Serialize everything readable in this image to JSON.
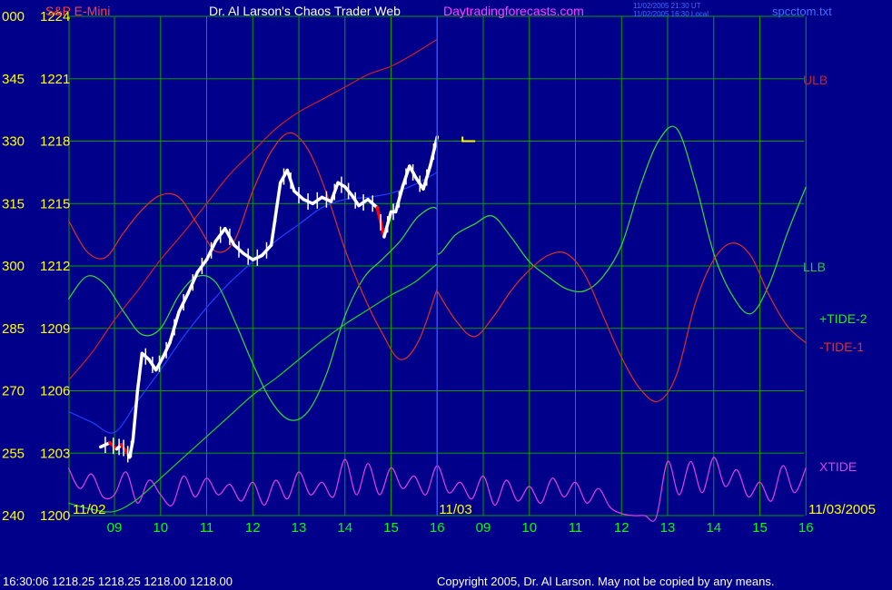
{
  "header": {
    "instrument": "S&P E-Mini",
    "author": "Dr. Al Larson's Chaos Trader Web",
    "site": "Daytradingforecasts.com",
    "timestamp_ut": "11/02/2005 21:30 UT",
    "timestamp_local": "11/02/2005 16:30 Local",
    "filename": "spcctom.txt"
  },
  "footer": {
    "quote": "16:30:06  1218.25  1218.25  1218.00  1218.00",
    "copyright": "Copyright 2005, Dr. Al Larson. May not be copied by any means."
  },
  "colors": {
    "background": "#00008b",
    "grid": "#00a000",
    "price_bar": "#ffffff",
    "down_bar": "#ff0000",
    "ulb": "#d02020",
    "llb": "#20d020",
    "tide_plus_2": "#30e030",
    "tide_minus_1": "#e03020",
    "xtide": "#e040e0",
    "average": "#2040ff",
    "now_line": "#3050ff",
    "axis_text": "#ffff00",
    "date_text": "#ffff00",
    "time_text": "#00ff00"
  },
  "chart_data": {
    "type": "line",
    "x_axis": {
      "date_labels": [
        "11/02",
        "11/03",
        "11/03/2005"
      ],
      "time_ticks": [
        "09",
        "10",
        "11",
        "12",
        "13",
        "14",
        "15",
        "16",
        "09",
        "10",
        "11",
        "12",
        "13",
        "14",
        "15",
        "16"
      ]
    },
    "y_axis": {
      "ylim": [
        1200,
        1224
      ],
      "ticks": [
        {
          "angle": "000",
          "price": "1224"
        },
        {
          "angle": "345",
          "price": "1221"
        },
        {
          "angle": "330",
          "price": "1218"
        },
        {
          "angle": "315",
          "price": "1215"
        },
        {
          "angle": "300",
          "price": "1212"
        },
        {
          "angle": "285",
          "price": "1209"
        },
        {
          "angle": "270",
          "price": "1206"
        },
        {
          "angle": "255",
          "price": "1203"
        },
        {
          "angle": "240",
          "price": "1200"
        }
      ]
    },
    "legend": [
      {
        "label": "ULB",
        "series": "ulb"
      },
      {
        "label": "LLB",
        "series": "llb"
      },
      {
        "label": "+TIDE-2",
        "series": "tide_plus_2"
      },
      {
        "label": "-TIDE-1",
        "series": "tide_minus_1"
      },
      {
        "label": "XTIDE",
        "series": "xtide"
      }
    ],
    "price": {
      "x": [
        8.7,
        8.9,
        9.05,
        9.15,
        9.25,
        9.33,
        9.4,
        9.5,
        9.6,
        9.75,
        9.9,
        10.05,
        10.2,
        10.4,
        10.6,
        10.8,
        11.0,
        11.2,
        11.4,
        11.6,
        11.8,
        12.0,
        12.2,
        12.4,
        12.6,
        12.75,
        12.9,
        13.1,
        13.3,
        13.5,
        13.7,
        13.85,
        14.0,
        14.15,
        14.3,
        14.5,
        14.7,
        14.85,
        15.0,
        15.1,
        15.25,
        15.4,
        15.55,
        15.7,
        15.85,
        16.0
      ],
      "y": [
        1203.3,
        1203.5,
        1203.2,
        1203.4,
        1203.1,
        1202.8,
        1203.6,
        1206.0,
        1207.8,
        1207.5,
        1207.0,
        1207.6,
        1208.3,
        1209.8,
        1210.7,
        1211.7,
        1212.3,
        1213.2,
        1213.8,
        1213.0,
        1212.6,
        1212.3,
        1212.5,
        1213.0,
        1216.0,
        1216.6,
        1215.6,
        1215.2,
        1215.0,
        1215.3,
        1215.1,
        1216.0,
        1215.8,
        1215.4,
        1214.9,
        1215.2,
        1214.8,
        1213.4,
        1214.6,
        1214.6,
        1215.8,
        1216.8,
        1216.2,
        1215.7,
        1216.8,
        1218.2
      ]
    },
    "series": [
      {
        "id": "ulb",
        "x": [
          8.0,
          8.5,
          9.0,
          9.5,
          10.0,
          10.5,
          11.0,
          11.5,
          12.0,
          12.5,
          13.0,
          13.5,
          14.0,
          14.5,
          15.0,
          15.5,
          16.0
        ],
        "y": [
          1206.5,
          1207.8,
          1209.4,
          1210.8,
          1212.3,
          1213.6,
          1215.0,
          1216.4,
          1217.5,
          1218.6,
          1219.4,
          1220.0,
          1220.6,
          1221.2,
          1221.6,
          1222.2,
          1222.9
        ]
      },
      {
        "id": "llb",
        "x": [
          8.0,
          8.5,
          9.0,
          9.5,
          10.0,
          10.5,
          11.0,
          11.5,
          12.0,
          12.5,
          13.0,
          13.5,
          14.0,
          14.5,
          15.0,
          15.5,
          16.0
        ],
        "y": [
          1200.6,
          1200.3,
          1200.2,
          1200.8,
          1201.8,
          1202.8,
          1203.8,
          1204.8,
          1205.8,
          1206.6,
          1207.5,
          1208.4,
          1209.2,
          1209.9,
          1210.6,
          1211.2,
          1212.1
        ]
      },
      {
        "id": "average",
        "x": [
          8.0,
          8.5,
          9.0,
          9.5,
          10.0,
          10.5,
          11.0,
          11.5,
          12.0,
          12.5,
          13.0,
          13.5,
          14.0,
          14.5,
          15.0,
          15.5,
          16.0
        ],
        "y": [
          1205.0,
          1204.5,
          1204.0,
          1205.5,
          1207.0,
          1208.6,
          1210.0,
          1211.2,
          1212.2,
          1213.2,
          1214.0,
          1214.8,
          1215.2,
          1215.3,
          1215.5,
          1215.9,
          1216.5
        ]
      },
      {
        "id": "tide_plus_2",
        "x": [
          8.0,
          8.4,
          8.8,
          9.2,
          9.6,
          10.0,
          10.4,
          10.8,
          11.2,
          11.6,
          12.0,
          12.4,
          12.8,
          13.2,
          13.6,
          14.0,
          14.4,
          14.8,
          15.2,
          15.6,
          16.0,
          16.0,
          16.4,
          16.8,
          17.2,
          17.6,
          18.0,
          18.4,
          18.8,
          19.2,
          19.6,
          20.0,
          20.4,
          20.8,
          21.2,
          21.6,
          22.0,
          22.4,
          22.8,
          23.2,
          23.6,
          24.0
        ],
        "y": [
          1210.4,
          1211.5,
          1211.1,
          1209.8,
          1208.7,
          1209.0,
          1210.6,
          1211.5,
          1211.2,
          1209.4,
          1207.3,
          1205.5,
          1204.6,
          1205.0,
          1206.8,
          1209.6,
          1211.4,
          1212.3,
          1213.2,
          1214.4,
          1214.7,
          1212.6,
          1213.5,
          1214.0,
          1214.4,
          1213.4,
          1212.2,
          1211.5,
          1210.9,
          1210.8,
          1211.5,
          1213.0,
          1215.8,
          1218.0,
          1218.6,
          1216.0,
          1212.6,
          1210.6,
          1209.7,
          1211.1,
          1213.6,
          1215.8
        ]
      },
      {
        "id": "tide_minus_1",
        "x": [
          8.0,
          8.4,
          8.8,
          9.2,
          9.6,
          10.0,
          10.4,
          10.8,
          11.2,
          11.6,
          12.0,
          12.4,
          12.8,
          13.2,
          13.6,
          14.0,
          14.4,
          14.8,
          15.2,
          15.6,
          16.0,
          16.0,
          16.4,
          16.8,
          17.2,
          17.6,
          18.0,
          18.4,
          18.8,
          19.2,
          19.6,
          20.0,
          20.4,
          20.8,
          21.2,
          21.6,
          22.0,
          22.4,
          22.8,
          23.2,
          23.6,
          24.0
        ],
        "y": [
          1214.2,
          1212.7,
          1212.4,
          1213.6,
          1214.7,
          1215.4,
          1215.3,
          1214.0,
          1212.7,
          1213.2,
          1215.6,
          1217.5,
          1218.4,
          1217.6,
          1215.5,
          1212.8,
          1210.6,
          1208.8,
          1207.5,
          1208.4,
          1210.9,
          1210.8,
          1209.4,
          1208.6,
          1209.5,
          1210.8,
          1211.8,
          1212.5,
          1212.6,
          1211.6,
          1209.6,
          1207.6,
          1206.1,
          1205.5,
          1206.8,
          1210.2,
          1212.3,
          1213.1,
          1212.5,
          1210.6,
          1209.1,
          1208.3
        ]
      },
      {
        "id": "xtide",
        "x": [
          8.0,
          8.25,
          8.5,
          8.75,
          9.0,
          9.25,
          9.5,
          9.75,
          10.0,
          10.25,
          10.5,
          10.75,
          11.0,
          11.25,
          11.5,
          11.75,
          12.0,
          12.25,
          12.5,
          12.75,
          13.0,
          13.25,
          13.5,
          13.75,
          14.0,
          14.25,
          14.5,
          14.75,
          15.0,
          15.25,
          15.5,
          15.75,
          16.0,
          16.25,
          16.5,
          16.75,
          17.0,
          17.25,
          17.5,
          17.75,
          18.0,
          18.25,
          18.5,
          18.75,
          19.0,
          19.25,
          19.5,
          19.75,
          20.0,
          20.25,
          20.5,
          20.75,
          21.0,
          21.25,
          21.5,
          21.75,
          22.0,
          22.25,
          22.5,
          22.75,
          23.0,
          23.25,
          23.5,
          23.75,
          24.0
        ],
        "y": [
          1202.3,
          1201.3,
          1202.0,
          1200.9,
          1201.0,
          1202.1,
          1200.6,
          1201.7,
          1201.0,
          1200.5,
          1201.9,
          1200.9,
          1201.8,
          1201.0,
          1201.5,
          1200.7,
          1201.6,
          1200.5,
          1201.7,
          1200.8,
          1202.1,
          1201.0,
          1201.6,
          1200.9,
          1202.7,
          1201.0,
          1202.5,
          1201.0,
          1202.3,
          1201.3,
          1201.9,
          1201.0,
          1202.4,
          1201.1,
          1201.6,
          1200.8,
          1201.9,
          1200.5,
          1201.7,
          1200.7,
          1201.4,
          1200.6,
          1201.8,
          1200.9,
          1201.6,
          1200.6,
          1201.3,
          1200.4,
          1200.1,
          1200.0,
          1200.0,
          1199.9,
          1202.6,
          1201.0,
          1202.6,
          1201.1,
          1202.8,
          1201.4,
          1202.2,
          1200.9,
          1201.6,
          1200.7,
          1202.4,
          1201.1,
          1202.3
        ]
      }
    ],
    "last_price_marker": 1218.0
  }
}
